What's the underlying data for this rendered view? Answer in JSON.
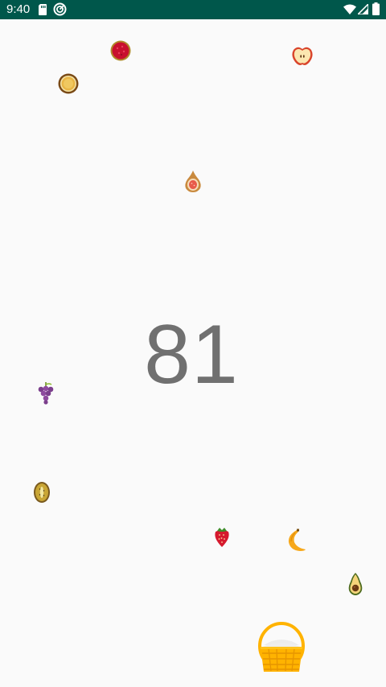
{
  "status_bar": {
    "time": "9:40",
    "left_icons": [
      "sd-card-icon",
      "sync-icon"
    ],
    "right_icons": [
      "wifi-icon",
      "cellular-signal-icon",
      "battery-icon"
    ],
    "color": "#00574b"
  },
  "game": {
    "score": "81",
    "fruits": [
      "pomegranate-icon",
      "apple-slice-icon",
      "orange-slice-icon",
      "fig-icon",
      "grapes-icon",
      "kiwi-icon",
      "strawberry-icon",
      "banana-icon",
      "avocado-icon"
    ],
    "player": "basket-icon",
    "colors": {
      "background": "#fafafa",
      "score_text": "#707070",
      "basket": "#ffb300"
    }
  }
}
